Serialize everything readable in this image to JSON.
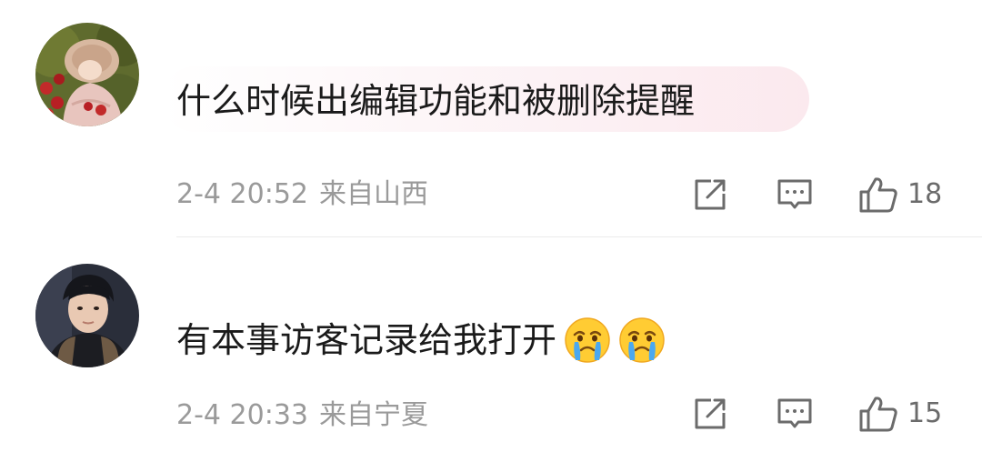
{
  "comments": [
    {
      "text": "什么时候出编辑功能和被删除提醒",
      "date": "2-4 20:52",
      "location": "来自山西",
      "like_count": "18",
      "avatar_icon": "avatar-girl-with-apples",
      "highlighted": true
    },
    {
      "text": "有本事访客记录给我打开",
      "emojis": [
        "crying-face-emoji",
        "crying-face-emoji"
      ],
      "date": "2-4 20:33",
      "location": "来自宁夏",
      "like_count": "15",
      "avatar_icon": "avatar-young-man"
    }
  ],
  "actions": {
    "share_icon": "share-icon",
    "reply_icon": "reply-icon",
    "like_icon": "thumbs-up-icon"
  },
  "colors": {
    "text": "#1a1a1a",
    "meta": "#9a9a9a",
    "icon": "#6b6b6b",
    "bubble_highlight": "#fbe9ee",
    "divider": "#ebebeb"
  }
}
